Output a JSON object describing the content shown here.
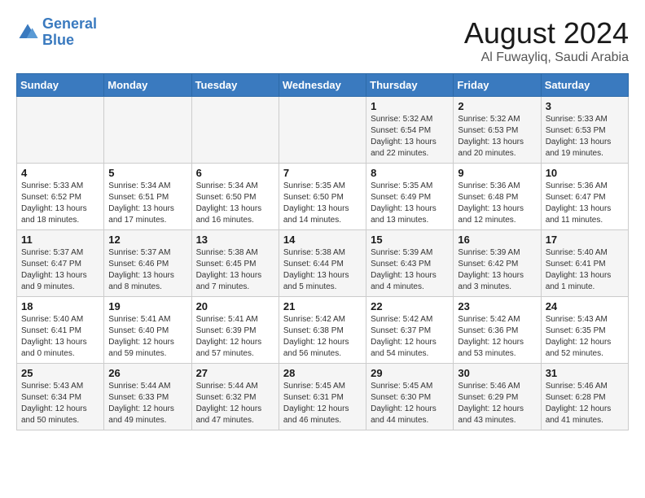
{
  "header": {
    "logo_line1": "General",
    "logo_line2": "Blue",
    "month_year": "August 2024",
    "location": "Al Fuwayliq, Saudi Arabia"
  },
  "weekdays": [
    "Sunday",
    "Monday",
    "Tuesday",
    "Wednesday",
    "Thursday",
    "Friday",
    "Saturday"
  ],
  "weeks": [
    [
      {
        "day": "",
        "info": ""
      },
      {
        "day": "",
        "info": ""
      },
      {
        "day": "",
        "info": ""
      },
      {
        "day": "",
        "info": ""
      },
      {
        "day": "1",
        "info": "Sunrise: 5:32 AM\nSunset: 6:54 PM\nDaylight: 13 hours\nand 22 minutes."
      },
      {
        "day": "2",
        "info": "Sunrise: 5:32 AM\nSunset: 6:53 PM\nDaylight: 13 hours\nand 20 minutes."
      },
      {
        "day": "3",
        "info": "Sunrise: 5:33 AM\nSunset: 6:53 PM\nDaylight: 13 hours\nand 19 minutes."
      }
    ],
    [
      {
        "day": "4",
        "info": "Sunrise: 5:33 AM\nSunset: 6:52 PM\nDaylight: 13 hours\nand 18 minutes."
      },
      {
        "day": "5",
        "info": "Sunrise: 5:34 AM\nSunset: 6:51 PM\nDaylight: 13 hours\nand 17 minutes."
      },
      {
        "day": "6",
        "info": "Sunrise: 5:34 AM\nSunset: 6:50 PM\nDaylight: 13 hours\nand 16 minutes."
      },
      {
        "day": "7",
        "info": "Sunrise: 5:35 AM\nSunset: 6:50 PM\nDaylight: 13 hours\nand 14 minutes."
      },
      {
        "day": "8",
        "info": "Sunrise: 5:35 AM\nSunset: 6:49 PM\nDaylight: 13 hours\nand 13 minutes."
      },
      {
        "day": "9",
        "info": "Sunrise: 5:36 AM\nSunset: 6:48 PM\nDaylight: 13 hours\nand 12 minutes."
      },
      {
        "day": "10",
        "info": "Sunrise: 5:36 AM\nSunset: 6:47 PM\nDaylight: 13 hours\nand 11 minutes."
      }
    ],
    [
      {
        "day": "11",
        "info": "Sunrise: 5:37 AM\nSunset: 6:47 PM\nDaylight: 13 hours\nand 9 minutes."
      },
      {
        "day": "12",
        "info": "Sunrise: 5:37 AM\nSunset: 6:46 PM\nDaylight: 13 hours\nand 8 minutes."
      },
      {
        "day": "13",
        "info": "Sunrise: 5:38 AM\nSunset: 6:45 PM\nDaylight: 13 hours\nand 7 minutes."
      },
      {
        "day": "14",
        "info": "Sunrise: 5:38 AM\nSunset: 6:44 PM\nDaylight: 13 hours\nand 5 minutes."
      },
      {
        "day": "15",
        "info": "Sunrise: 5:39 AM\nSunset: 6:43 PM\nDaylight: 13 hours\nand 4 minutes."
      },
      {
        "day": "16",
        "info": "Sunrise: 5:39 AM\nSunset: 6:42 PM\nDaylight: 13 hours\nand 3 minutes."
      },
      {
        "day": "17",
        "info": "Sunrise: 5:40 AM\nSunset: 6:41 PM\nDaylight: 13 hours\nand 1 minute."
      }
    ],
    [
      {
        "day": "18",
        "info": "Sunrise: 5:40 AM\nSunset: 6:41 PM\nDaylight: 13 hours\nand 0 minutes."
      },
      {
        "day": "19",
        "info": "Sunrise: 5:41 AM\nSunset: 6:40 PM\nDaylight: 12 hours\nand 59 minutes."
      },
      {
        "day": "20",
        "info": "Sunrise: 5:41 AM\nSunset: 6:39 PM\nDaylight: 12 hours\nand 57 minutes."
      },
      {
        "day": "21",
        "info": "Sunrise: 5:42 AM\nSunset: 6:38 PM\nDaylight: 12 hours\nand 56 minutes."
      },
      {
        "day": "22",
        "info": "Sunrise: 5:42 AM\nSunset: 6:37 PM\nDaylight: 12 hours\nand 54 minutes."
      },
      {
        "day": "23",
        "info": "Sunrise: 5:42 AM\nSunset: 6:36 PM\nDaylight: 12 hours\nand 53 minutes."
      },
      {
        "day": "24",
        "info": "Sunrise: 5:43 AM\nSunset: 6:35 PM\nDaylight: 12 hours\nand 52 minutes."
      }
    ],
    [
      {
        "day": "25",
        "info": "Sunrise: 5:43 AM\nSunset: 6:34 PM\nDaylight: 12 hours\nand 50 minutes."
      },
      {
        "day": "26",
        "info": "Sunrise: 5:44 AM\nSunset: 6:33 PM\nDaylight: 12 hours\nand 49 minutes."
      },
      {
        "day": "27",
        "info": "Sunrise: 5:44 AM\nSunset: 6:32 PM\nDaylight: 12 hours\nand 47 minutes."
      },
      {
        "day": "28",
        "info": "Sunrise: 5:45 AM\nSunset: 6:31 PM\nDaylight: 12 hours\nand 46 minutes."
      },
      {
        "day": "29",
        "info": "Sunrise: 5:45 AM\nSunset: 6:30 PM\nDaylight: 12 hours\nand 44 minutes."
      },
      {
        "day": "30",
        "info": "Sunrise: 5:46 AM\nSunset: 6:29 PM\nDaylight: 12 hours\nand 43 minutes."
      },
      {
        "day": "31",
        "info": "Sunrise: 5:46 AM\nSunset: 6:28 PM\nDaylight: 12 hours\nand 41 minutes."
      }
    ]
  ]
}
